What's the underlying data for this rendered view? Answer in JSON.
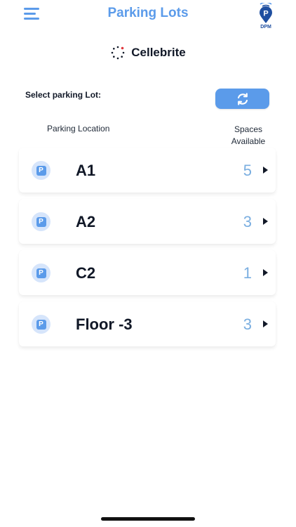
{
  "header": {
    "title": "Parking Lots",
    "menu_icon": "hamburger-menu-icon",
    "logo_text": "DPM",
    "logo_letter": "P"
  },
  "brand": {
    "name": "Cellebrite",
    "icon": "cellebrite-logo-icon"
  },
  "selector": {
    "label": "Select parking Lot:",
    "refresh_icon": "refresh-icon"
  },
  "columns": {
    "location": "Parking Location",
    "spaces_line1": "Spaces",
    "spaces_line2": "Available"
  },
  "lots": [
    {
      "name": "A1",
      "spaces": "5"
    },
    {
      "name": "A2",
      "spaces": "3"
    },
    {
      "name": "C2",
      "spaces": "1"
    },
    {
      "name": "Floor -3",
      "spaces": "3"
    }
  ],
  "lot_icon_letter": "P",
  "colors": {
    "accent": "#5b9bea",
    "count": "#7aaee0",
    "icon_bg": "#d6e5fb",
    "logo_dark": "#1f4fa0"
  }
}
